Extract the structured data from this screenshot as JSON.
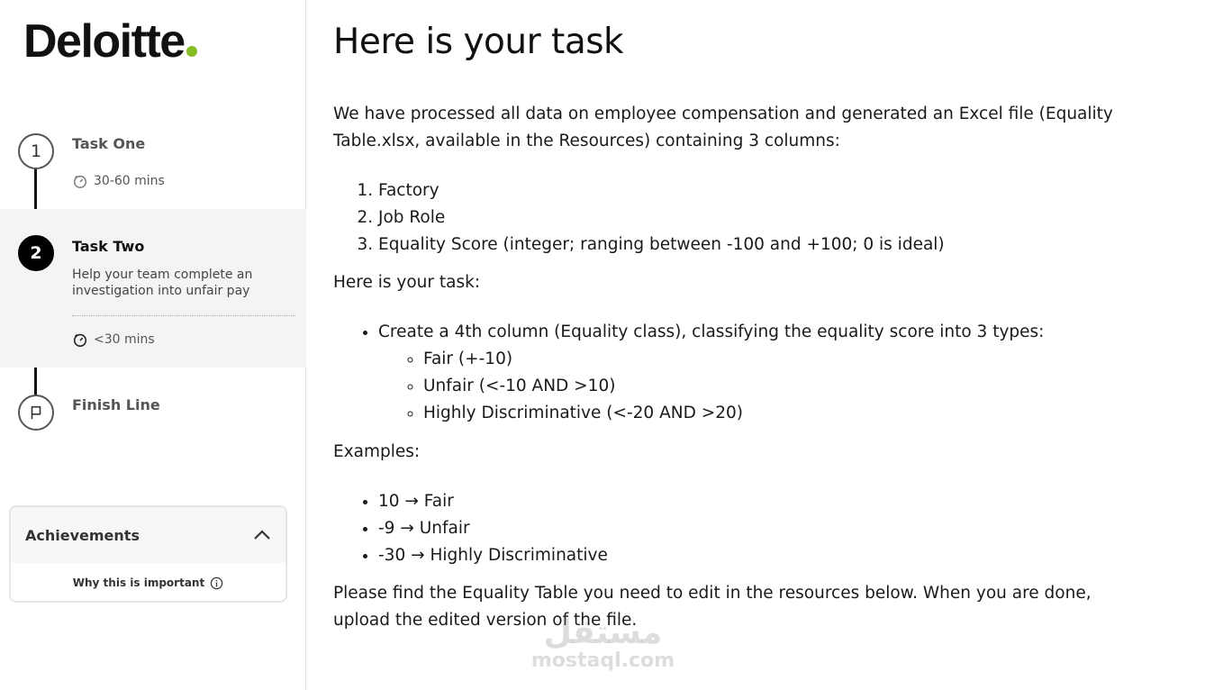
{
  "sidebar": {
    "logo": "Deloitte",
    "steps": [
      {
        "number": "1",
        "title": "Task One",
        "time": "30-60 mins"
      },
      {
        "number": "2",
        "title": "Task Two",
        "description": "Help your team complete an investigation into unfair pay",
        "time": "<30 mins"
      },
      {
        "title": "Finish Line"
      }
    ],
    "achievements": {
      "title": "Achievements",
      "link": "Why this is important"
    }
  },
  "main": {
    "title": "Here is your task",
    "intro": "We have processed all data on employee compensation and generated an Excel file (Equality Table.xlsx, available in the Resources) containing 3 columns:",
    "columns": [
      "Factory",
      "Job Role",
      "Equality Score (integer; ranging between -100 and +100; 0 is ideal)"
    ],
    "task_heading": "Here is your task:",
    "task_item": "Create a 4th column (Equality class), classifying the equality score into 3 types:",
    "types": [
      "Fair (+-10)",
      "Unfair (<-10 AND >10)",
      "Highly Discriminative (<-20 AND >20)"
    ],
    "examples_heading": "Examples:",
    "examples": [
      "10 → Fair",
      "-9 → Unfair",
      "-30 → Highly Discriminative"
    ],
    "closing": "Please find the Equality Table you need to edit in the resources below. When you are done, upload the edited version of the file."
  },
  "watermark": {
    "arabic": "مستقل",
    "domain": "mostaql.com"
  },
  "colors": {
    "brand_green": "#86bc25",
    "active_step_bg": "#f4f4f4"
  }
}
